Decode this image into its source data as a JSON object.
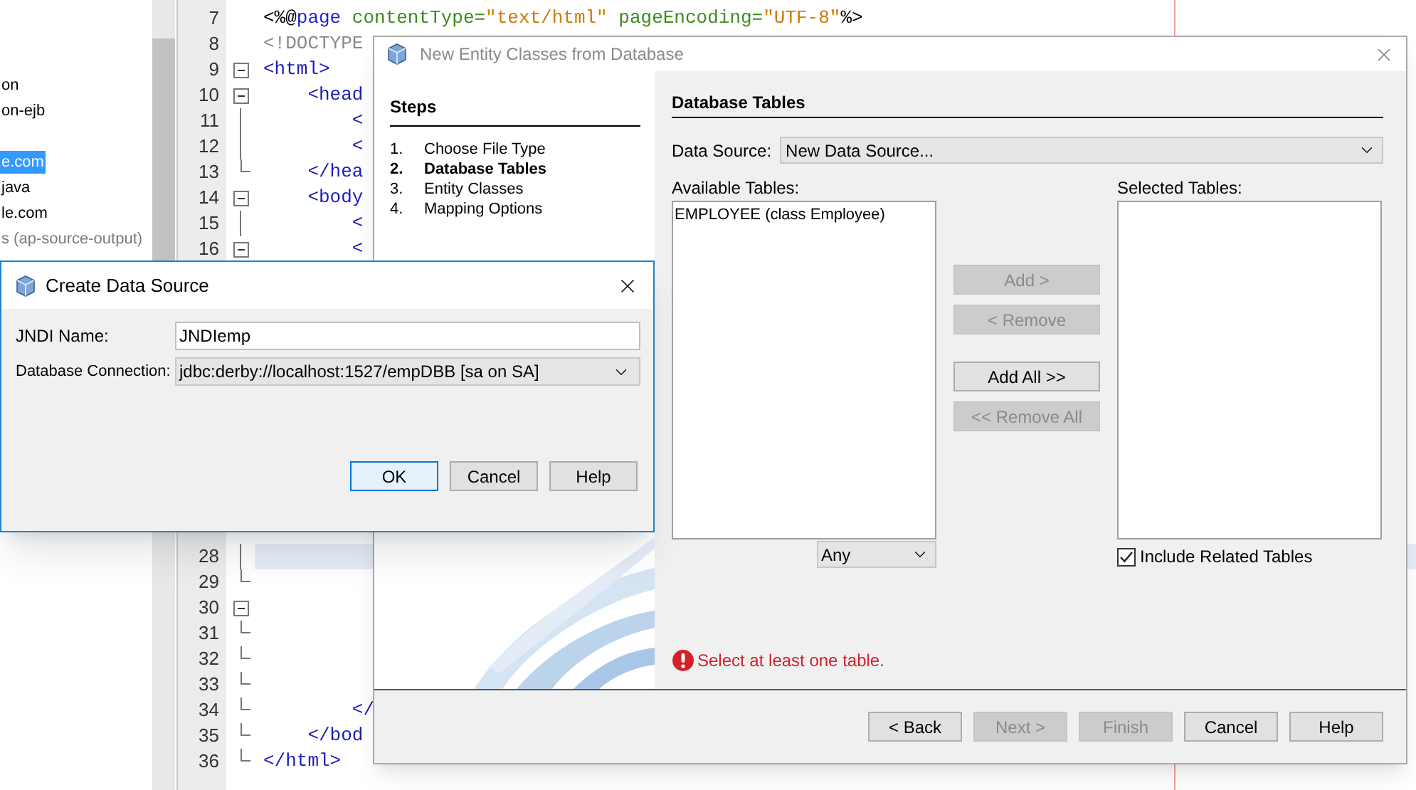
{
  "project_tree": {
    "items": [
      {
        "label": "on",
        "selected": false,
        "dimmed": false
      },
      {
        "label": "on-ejb",
        "selected": false,
        "dimmed": false
      },
      {
        "label": "e.com",
        "selected": true,
        "dimmed": false
      },
      {
        "label": "java",
        "selected": false,
        "dimmed": false
      },
      {
        "label": "le.com",
        "selected": false,
        "dimmed": false
      },
      {
        "label": "s (ap-source-output)",
        "selected": false,
        "dimmed": true
      }
    ]
  },
  "editor": {
    "lines": [
      {
        "number": "7",
        "kind": "plain",
        "current": false,
        "segments": [
          {
            "text": "<%@",
            "kind": "plain"
          },
          {
            "text": "page",
            "kind": "keyword"
          },
          {
            "text": " contentType=",
            "kind": "attr"
          },
          {
            "text": "\"text/html\"",
            "kind": "string"
          },
          {
            "text": " pageEncoding=",
            "kind": "attr"
          },
          {
            "text": "\"UTF-8\"",
            "kind": "string"
          },
          {
            "text": "%>",
            "kind": "plain"
          }
        ]
      },
      {
        "number": "8",
        "kind": "plain",
        "current": false,
        "segments": [
          {
            "text": "<!DOCTYPE",
            "kind": "doctype"
          }
        ]
      },
      {
        "number": "9",
        "kind": "fold-start",
        "current": false,
        "segments": [
          {
            "text": "<html>",
            "kind": "tag"
          }
        ]
      },
      {
        "number": "10",
        "kind": "fold-start",
        "current": false,
        "segments": [
          {
            "text": "    <head",
            "kind": "tag"
          }
        ]
      },
      {
        "number": "11",
        "kind": "fold-body",
        "current": false,
        "segments": [
          {
            "text": "        <",
            "kind": "tag"
          }
        ]
      },
      {
        "number": "12",
        "kind": "fold-body",
        "current": false,
        "segments": [
          {
            "text": "        <",
            "kind": "tag"
          }
        ]
      },
      {
        "number": "13",
        "kind": "fold-end",
        "current": false,
        "segments": [
          {
            "text": "    </hea",
            "kind": "tag"
          }
        ]
      },
      {
        "number": "14",
        "kind": "fold-start",
        "current": false,
        "segments": [
          {
            "text": "    <body",
            "kind": "tag"
          }
        ]
      },
      {
        "number": "15",
        "kind": "fold-body",
        "current": false,
        "segments": [
          {
            "text": "        <",
            "kind": "tag"
          }
        ]
      },
      {
        "number": "16",
        "kind": "fold-start",
        "current": false,
        "segments": [
          {
            "text": "        <",
            "kind": "tag"
          }
        ]
      },
      {
        "number": "28",
        "kind": "fold-body",
        "current": true
      },
      {
        "number": "29",
        "kind": "fold-end",
        "current": false
      },
      {
        "number": "30",
        "kind": "fold-start",
        "current": false
      },
      {
        "number": "31",
        "kind": "fold-end",
        "current": false
      },
      {
        "number": "32",
        "kind": "fold-end",
        "current": false
      },
      {
        "number": "33",
        "kind": "fold-end",
        "current": false
      },
      {
        "number": "34",
        "kind": "fold-end",
        "current": false,
        "segments": [
          {
            "text": "        </",
            "kind": "tag"
          }
        ]
      },
      {
        "number": "35",
        "kind": "fold-end",
        "current": false,
        "segments": [
          {
            "text": "    </bod",
            "kind": "tag"
          }
        ]
      },
      {
        "number": "36",
        "kind": "fold-end",
        "current": false,
        "segments": [
          {
            "text": "</html>",
            "kind": "tag"
          }
        ]
      }
    ]
  },
  "entity_dialog": {
    "title": "New Entity Classes from Database",
    "steps_title": "Steps",
    "steps": [
      {
        "number": "1.",
        "label": "Choose File Type",
        "selected": false
      },
      {
        "number": "2.",
        "label": "Database Tables",
        "selected": true
      },
      {
        "number": "3.",
        "label": "Entity Classes",
        "selected": false
      },
      {
        "number": "4.",
        "label": "Mapping Options",
        "selected": false
      }
    ],
    "panel_title": "Database Tables",
    "data_source": {
      "label": "Data Source:",
      "value": "New Data Source..."
    },
    "available_tables": {
      "label": "Available Tables:",
      "items": [
        {
          "label": "EMPLOYEE (class Employee)",
          "selected": false
        }
      ]
    },
    "filter": {
      "value": "Any"
    },
    "transfer_buttons": [
      {
        "label": "Add >",
        "disabled": true
      },
      {
        "label": "< Remove",
        "disabled": true
      },
      {
        "label": "Add All >>",
        "disabled": false
      },
      {
        "label": "<< Remove All",
        "disabled": true
      }
    ],
    "selected_tables": {
      "label": "Selected Tables:"
    },
    "include_related": {
      "label": "Include Related Tables",
      "checked": true
    },
    "error": {
      "message": "Select at least one table."
    },
    "buttons": [
      {
        "label": "< Back",
        "disabled": false
      },
      {
        "label": "Next >",
        "disabled": true
      },
      {
        "label": "Finish",
        "disabled": true
      },
      {
        "label": "Cancel",
        "disabled": false
      },
      {
        "label": "Help",
        "disabled": false
      }
    ]
  },
  "create_dialog": {
    "title": "Create Data Source",
    "jndi_name": {
      "label": "JNDI Name:",
      "value": "JNDIemp"
    },
    "connection": {
      "label": "Database Connection:",
      "value": "jdbc:derby://localhost:1527/empDBB [sa on SA]"
    },
    "buttons": [
      {
        "label": "OK",
        "focused": true
      },
      {
        "label": "Cancel",
        "focused": false
      },
      {
        "label": "Help",
        "focused": false
      }
    ]
  }
}
